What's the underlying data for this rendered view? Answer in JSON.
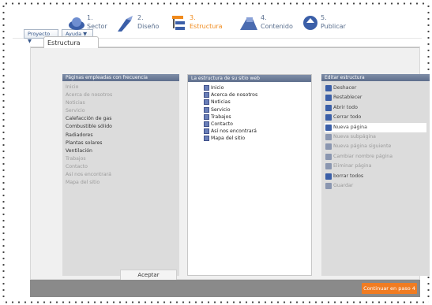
{
  "toolbar": {
    "project_menu": "Proyecto ▼",
    "help_menu": "Ayuda ▼"
  },
  "steps": [
    {
      "num": "1.",
      "label": "Sector",
      "active": false,
      "icon": "world-icon"
    },
    {
      "num": "2.",
      "label": "Diseño",
      "active": false,
      "icon": "brush-icon"
    },
    {
      "num": "3.",
      "label": "Estructura",
      "active": true,
      "icon": "structure-icon"
    },
    {
      "num": "4.",
      "label": "Contenido",
      "active": false,
      "icon": "content-icon"
    },
    {
      "num": "5.",
      "label": "Publicar",
      "active": false,
      "icon": "publish-icon"
    }
  ],
  "tab": {
    "label": "Estructura"
  },
  "frequent_panel": {
    "title": "Páginas empleadas con frecuencia",
    "items": [
      {
        "label": "Inicio",
        "bold": false
      },
      {
        "label": "Acerca de nosotros",
        "bold": false
      },
      {
        "label": "Noticias",
        "bold": false
      },
      {
        "label": "Servicio",
        "bold": false
      },
      {
        "label": "Calefacción de gas",
        "bold": true
      },
      {
        "label": "Combustible sólido",
        "bold": true
      },
      {
        "label": "Radiadores",
        "bold": true
      },
      {
        "label": "Plantas solares",
        "bold": true
      },
      {
        "label": "Ventilación",
        "bold": true
      },
      {
        "label": "Trabajos",
        "bold": false
      },
      {
        "label": "Contacto",
        "bold": false
      },
      {
        "label": "Así nos encontrará",
        "bold": false
      },
      {
        "label": "Mapa del sitio",
        "bold": false
      }
    ],
    "accept_label": "Aceptar"
  },
  "structure_panel": {
    "title": "La estructura de su sitio web",
    "items": [
      "Inicio",
      "Acerca de nosotros",
      "Noticias",
      "Servicio",
      "Trabajos",
      "Contacto",
      "Así nos encontrará",
      "Mapa del sitio"
    ]
  },
  "edit_panel": {
    "title": "Editar estructura",
    "actions": [
      {
        "label": "Deshacer",
        "enabled": true,
        "selected": false,
        "icon": "undo-icon",
        "color": "#3b5fa8"
      },
      {
        "label": "Restablecer",
        "enabled": true,
        "selected": false,
        "icon": "reset-icon",
        "color": "#3b5fa8"
      },
      {
        "label": "Abrir todo",
        "enabled": true,
        "selected": false,
        "icon": "expand-icon",
        "color": "#3b5fa8"
      },
      {
        "label": "Cerrar todo",
        "enabled": true,
        "selected": false,
        "icon": "collapse-icon",
        "color": "#3b5fa8"
      },
      {
        "label": "Nueva página",
        "enabled": true,
        "selected": true,
        "icon": "new-page-icon",
        "color": "#3b5fa8"
      },
      {
        "label": "Nueva subpágina",
        "enabled": false,
        "selected": false,
        "icon": "new-subpage-icon",
        "color": "#8a96b0"
      },
      {
        "label": "Nueva página siguiente",
        "enabled": false,
        "selected": false,
        "icon": "new-next-page-icon",
        "color": "#8a96b0"
      },
      {
        "label": "Cambiar nombre página",
        "enabled": false,
        "selected": false,
        "icon": "rename-icon",
        "color": "#8a96b0"
      },
      {
        "label": "Eliminar página",
        "enabled": false,
        "selected": false,
        "icon": "delete-icon",
        "color": "#8a96b0"
      },
      {
        "label": "borrar todos",
        "enabled": true,
        "selected": false,
        "icon": "clear-all-icon",
        "color": "#3b5fa8"
      },
      {
        "label": "Guardar",
        "enabled": false,
        "selected": false,
        "icon": "save-icon",
        "color": "#8a96b0"
      }
    ]
  },
  "footer": {
    "next_label": "Continuar en paso 4"
  },
  "colors": {
    "accent": "#f07c22",
    "panel_header": "#6a7a96"
  }
}
